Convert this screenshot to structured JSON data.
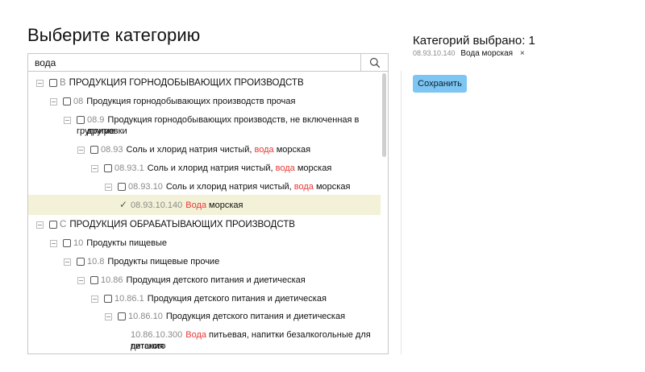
{
  "page": {
    "title": "Выберите категорию"
  },
  "search": {
    "value": "вода",
    "placeholder": "",
    "icon": "search-icon"
  },
  "tree": [
    {
      "code": "B",
      "before": "ПРОДУКЦИЯ ГОРНОДОБЫВАЮЩИХ ПРОИЗВОДСТВ",
      "match": "",
      "after": "",
      "checked": false
    },
    {
      "code": "08",
      "before": "Продукция горнодобывающих производств прочая",
      "match": "",
      "after": "",
      "checked": false
    },
    {
      "code": "08.9",
      "before": "Продукция горнодобывающих производств, не включенная в другие",
      "match": "",
      "after": "",
      "line2": "группировки",
      "checked": false
    },
    {
      "code": "08.93",
      "before": "Соль и хлорид натрия чистый, ",
      "match": "вода",
      "after": " морская",
      "checked": false
    },
    {
      "code": "08.93.1",
      "before": "Соль и хлорид натрия чистый, ",
      "match": "вода",
      "after": " морская",
      "checked": false
    },
    {
      "code": "08.93.10",
      "before": "Соль и хлорид натрия чистый, ",
      "match": "вода",
      "after": " морская",
      "checked": false
    },
    {
      "code": "08.93.10.140",
      "before": "",
      "match": "Вода",
      "after": " морская",
      "checked": true
    },
    {
      "code": "C",
      "before": "ПРОДУКЦИЯ ОБРАБАТЫВАЮЩИХ ПРОИЗВОДСТВ",
      "match": "",
      "after": "",
      "checked": false
    },
    {
      "code": "10",
      "before": "Продукты пищевые",
      "match": "",
      "after": "",
      "checked": false
    },
    {
      "code": "10.8",
      "before": "Продукты пищевые прочие",
      "match": "",
      "after": "",
      "checked": false
    },
    {
      "code": "10.86",
      "before": "Продукция детского питания и диетическая",
      "match": "",
      "after": "",
      "checked": false
    },
    {
      "code": "10.86.1",
      "before": "Продукция детского питания и диетическая",
      "match": "",
      "after": "",
      "checked": false
    },
    {
      "code": "10.86.10",
      "before": "Продукция детского питания и диетическая",
      "match": "",
      "after": "",
      "checked": false
    },
    {
      "code": "10.86.10.300",
      "before": "",
      "match": "Вода",
      "after": " питьевая, напитки безалкогольные для детского",
      "line2": "питания",
      "checked": false
    }
  ],
  "selection": {
    "title": "Категорий выбрано: 1",
    "items": [
      {
        "code": "08.93.10.140",
        "label": "Вода морская",
        "remove": "×"
      }
    ],
    "save_label": "Сохранить"
  },
  "colors": {
    "highlight": "#e53935",
    "selected_row": "#f3f2d8",
    "save_button": "#7dc6f3"
  }
}
